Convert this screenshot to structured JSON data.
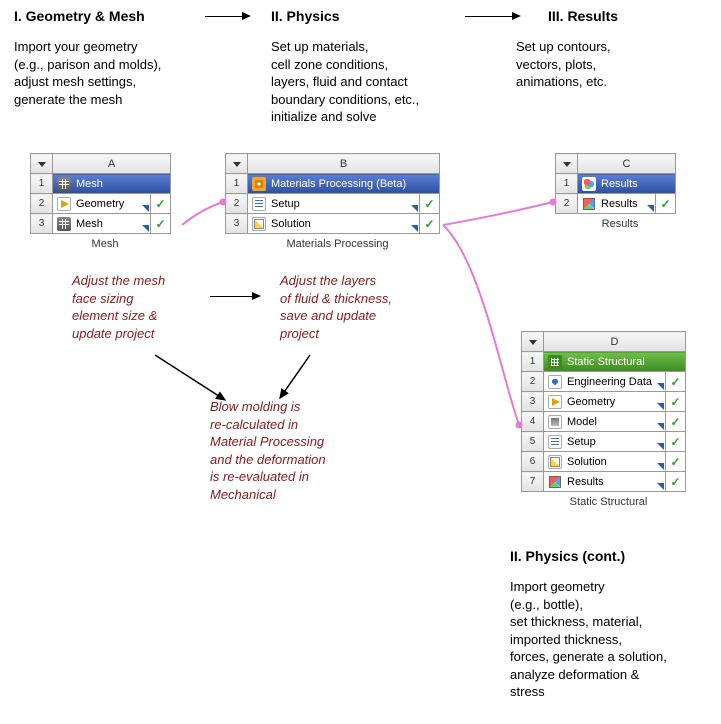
{
  "headings": {
    "geometry": "I. Geometry & Mesh",
    "physics": "II. Physics",
    "results": "III. Results",
    "physics_cont": "II. Physics (cont.)"
  },
  "descriptions": {
    "geometry": "Import your geometry\n(e.g., parison and molds),\nadjust mesh settings,\ngenerate the mesh",
    "physics": "Set up materials,\ncell zone conditions,\nlayers, fluid and contact\nboundary conditions, etc.,\ninitialize and solve",
    "results": "Set up contours,\nvectors, plots,\nanimations, etc.",
    "physics_cont": "Import geometry\n(e.g., bottle),\nset thickness, material,\nimported thickness,\nforces, generate a solution,\nanalyze deformation &\nstress"
  },
  "schematics": {
    "A": {
      "col": "A",
      "caption": "Mesh",
      "header": {
        "label": "Mesh",
        "icon": "mesh"
      },
      "rows": [
        {
          "num": "2",
          "icon": "geom",
          "label": "Geometry",
          "status": "✓"
        },
        {
          "num": "3",
          "icon": "mesh",
          "label": "Mesh",
          "status": "✓"
        }
      ]
    },
    "B": {
      "col": "B",
      "caption": "Materials Processing",
      "header": {
        "label": "Materials Processing (Beta)",
        "icon": "matproc"
      },
      "rows": [
        {
          "num": "2",
          "icon": "setup",
          "label": "Setup",
          "status": "✓"
        },
        {
          "num": "3",
          "icon": "solution",
          "label": "Solution",
          "status": "✓"
        }
      ]
    },
    "C": {
      "col": "C",
      "caption": "Results",
      "header": {
        "label": "Results",
        "icon": "results"
      },
      "rows": [
        {
          "num": "2",
          "icon": "cube",
          "label": "Results",
          "status": "✓"
        }
      ]
    },
    "D": {
      "col": "D",
      "caption": "Static Structural",
      "header": {
        "label": "Static Structural",
        "icon": "static",
        "green": true
      },
      "rows": [
        {
          "num": "2",
          "icon": "engdata",
          "label": "Engineering Data",
          "status": "✓"
        },
        {
          "num": "3",
          "icon": "geom",
          "label": "Geometry",
          "status": "✓"
        },
        {
          "num": "4",
          "icon": "model",
          "label": "Model",
          "status": "✓"
        },
        {
          "num": "5",
          "icon": "setup",
          "label": "Setup",
          "status": "✓"
        },
        {
          "num": "6",
          "icon": "solution",
          "label": "Solution",
          "status": "✓"
        },
        {
          "num": "7",
          "icon": "cube",
          "label": "Results",
          "status": "✓"
        }
      ]
    }
  },
  "annotations": {
    "adjust_mesh": "Adjust the mesh\nface sizing\nelement size &\nupdate project",
    "adjust_layers": "Adjust the layers\nof fluid & thickness,\nsave and update\nproject",
    "recalc": "Blow molding is\nre-calculated in\nMaterial Processing\nand the deformation\nis re-evaluated in\nMechanical"
  }
}
